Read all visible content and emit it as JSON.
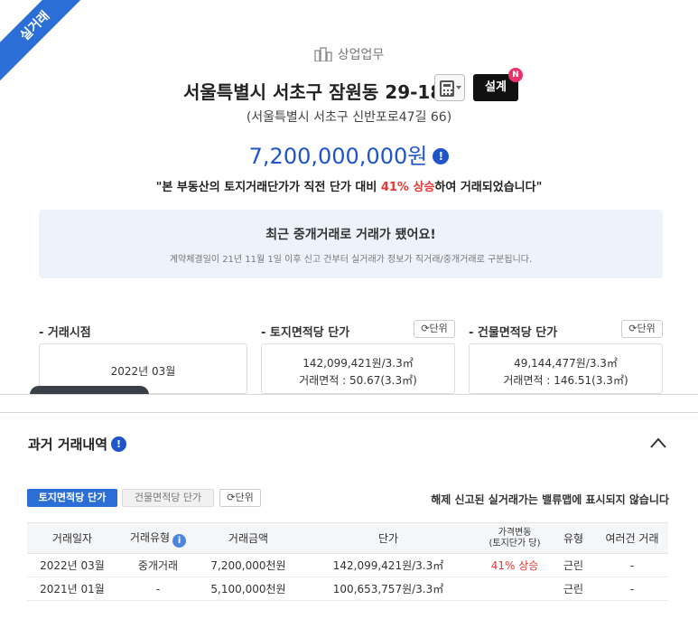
{
  "ribbon": {
    "label": "실거래"
  },
  "header": {
    "category": "상업업무",
    "address": "서울특별시 서초구 잠원동 29-18",
    "design_label": "설계",
    "new_badge": "N",
    "road_address": "(서울특별시 서초구 신반포로47길 66)",
    "price": "7,200,000,000원",
    "note_prefix": "\"본 부동산의 토지거래단가가 직전 단가 대비 ",
    "note_change": "41% 상승",
    "note_suffix": "하여 거래되었습니다\""
  },
  "notice": {
    "title": "최근 중개거래로 거래가 됐어요!",
    "subtitle": "계약체결일이 21년 11월 1일 이후 신고 건부터 실거래가 정보가 직거래/중개거래로 구분됩니다."
  },
  "stats": {
    "deal_date": {
      "label": "- 거래시점",
      "value": "2022년 03월"
    },
    "land_unit": {
      "label": "- 토지면적당 단가",
      "unit_button": "단위",
      "price": "142,099,421원/3.3㎡",
      "area": "거래면적 : 50.67(3.3㎡)"
    },
    "bldg_unit": {
      "label": "- 건물면적당 단가",
      "unit_button": "단위",
      "price": "49,144,477원/3.3㎡",
      "area": "거래면적 : 146.51(3.3㎡)"
    }
  },
  "history": {
    "title": "과거 거래내역",
    "tab_land": "토지면적당 단가",
    "tab_bldg": "건물면적당 단가",
    "unit_button": "단위",
    "note": "해제 신고된 실거래가는 밸류맵에 표시되지 않습니다",
    "columns": {
      "date": "거래일자",
      "type": "거래유형",
      "amount": "거래금액",
      "unit_price": "단가",
      "change_line1": "가격변동",
      "change_line2": "(토지단가 당)",
      "category": "유형",
      "multi": "여러건 거래"
    },
    "rows": [
      {
        "date": "2022년 03월",
        "type": "중개거래",
        "amount": "7,200,000천원",
        "unit_price": "142,099,421원/3.3㎡",
        "change": "41% 상승",
        "category": "근린",
        "multi": "-"
      },
      {
        "date": "2021년 01월",
        "type": "-",
        "amount": "5,100,000천원",
        "unit_price": "100,653,757원/3.3㎡",
        "change": "",
        "category": "근린",
        "multi": "-"
      }
    ]
  },
  "colors": {
    "accent": "#2b6fd6",
    "price": "#1f55c9",
    "up": "#e53935",
    "badge": "#e8336b"
  }
}
